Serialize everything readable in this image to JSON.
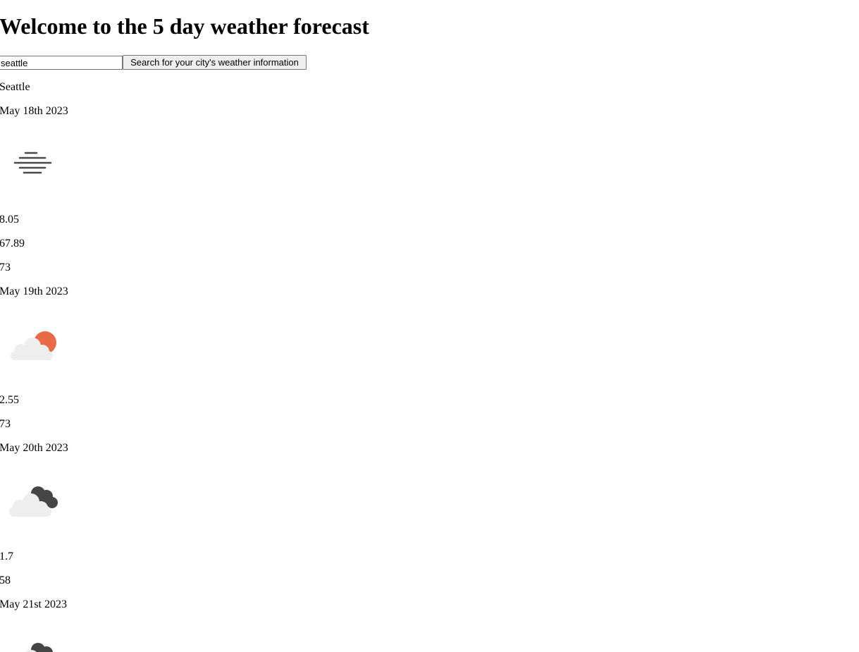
{
  "page": {
    "heading": "Welcome to the 5 day weather forecast"
  },
  "search": {
    "value": "seattle",
    "button_label": "Search for your city's weather information"
  },
  "forecast": {
    "city": "Seattle",
    "days": [
      {
        "date": "May 18th 2023",
        "icon": "mist-icon",
        "values": [
          "8.05",
          "67.89",
          "73"
        ]
      },
      {
        "date": "May 19th 2023",
        "icon": "partly-cloudy-icon",
        "values": [
          "2.55",
          "73"
        ]
      },
      {
        "date": "May 20th 2023",
        "icon": "cloudy-icon",
        "values": [
          "1.7",
          "58"
        ]
      },
      {
        "date": "May 21st 2023",
        "icon": "cloudy-icon",
        "values": []
      }
    ]
  },
  "colors": {
    "mist_lines": "#4a4a4a",
    "sun": "#e96a47",
    "light_cloud": "#eeeeee",
    "dark_cloud": "#454545"
  }
}
